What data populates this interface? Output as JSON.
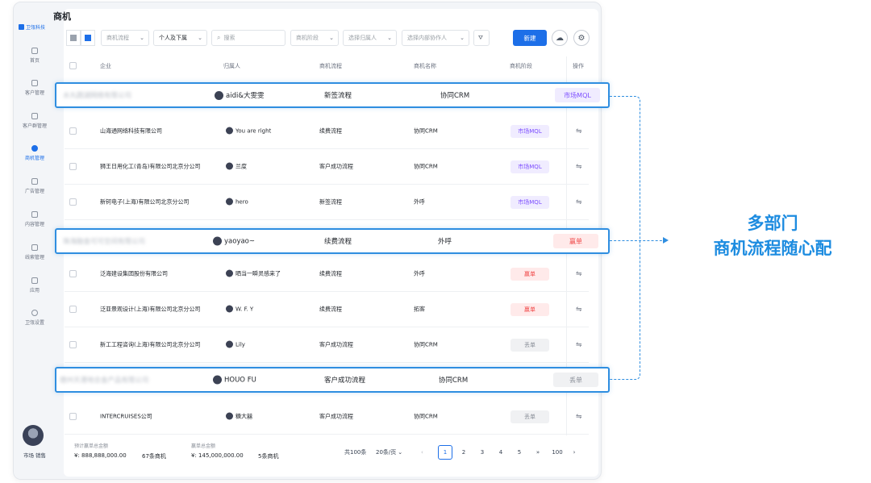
{
  "app": {
    "logo_text": "卫瓴科技",
    "page_title": "商机"
  },
  "sidebar": {
    "items": [
      {
        "label": "首页",
        "icon": "home-icon"
      },
      {
        "label": "客户管理",
        "icon": "customer-icon"
      },
      {
        "label": "客户群管理",
        "icon": "group-icon"
      },
      {
        "label": "商机管理",
        "icon": "opportunity-icon",
        "active": true
      },
      {
        "label": "广告管理",
        "icon": "ad-icon"
      },
      {
        "label": "内容管理",
        "icon": "content-icon"
      },
      {
        "label": "线索管理",
        "icon": "lead-icon"
      },
      {
        "label": "应用",
        "icon": "apps-icon"
      },
      {
        "label": "卫瓴设置",
        "icon": "settings-icon"
      }
    ],
    "user_label": "市场 销售"
  },
  "toolbar": {
    "process_filter": "商机流程",
    "scope_filter": "个人及下属",
    "search_placeholder": "搜索",
    "stage_filter": "商机阶段",
    "owner_filter": "选择归属人",
    "collab_filter": "选择内部协作人",
    "new_label": "新建"
  },
  "table": {
    "columns": [
      "企业",
      "归属人",
      "商机流程",
      "商机名称",
      "商机阶段",
      "操作"
    ],
    "rows": [
      {
        "company": "山海通网络科技有限公司",
        "owner": "You are right",
        "process": "续费流程",
        "name": "协同CRM",
        "stage": "市场MQL",
        "stage_type": "mql"
      },
      {
        "company": "狮王日用化工(青岛)有限公司北京分公司",
        "owner": "兰度",
        "process": "客户成功流程",
        "name": "协同CRM",
        "stage": "市场MQL",
        "stage_type": "mql"
      },
      {
        "company": "新钶电子(上海)有限公司北京分公司",
        "owner": "hero",
        "process": "新签流程",
        "name": "外呼",
        "stage": "市场MQL",
        "stage_type": "mql"
      },
      {
        "company": "泛海建设集团股份有限公司",
        "owner": "晒当一瞬灵感来了",
        "process": "续费流程",
        "name": "外呼",
        "stage": "赢单",
        "stage_type": "win"
      },
      {
        "company": "泛亚景观设计(上海)有限公司北京分公司",
        "owner": "W. F. Y",
        "process": "续费流程",
        "name": "拓客",
        "stage": "赢单",
        "stage_type": "win"
      },
      {
        "company": "新工工程咨询(上海)有限公司北京分公司",
        "owner": "Lily",
        "process": "客户成功流程",
        "name": "协同CRM",
        "stage": "丢单",
        "stage_type": "lost"
      },
      {
        "company": "INTERCRUISES公司",
        "owner": "糖大囍",
        "process": "客户成功流程",
        "name": "协同CRM",
        "stage": "丢单",
        "stage_type": "lost"
      }
    ]
  },
  "highlights": [
    {
      "company": "水丸圆湖网络有限公司",
      "owner": "aidi&大雯雯",
      "process": "新签流程",
      "name": "协同CRM",
      "stage": "市场MQL",
      "stage_type": "mql"
    },
    {
      "company": "珠海融金可可空间有限公司",
      "owner": "yaoyao~",
      "process": "续费流程",
      "name": "外呼",
      "stage": "赢单",
      "stage_type": "win"
    },
    {
      "company": "德州天港地合金产品有限公司",
      "owner": "HOUO FU",
      "process": "客户成功流程",
      "name": "协同CRM",
      "stage": "丢单",
      "stage_type": "lost"
    }
  ],
  "slogan": {
    "line1": "多部门",
    "line2": "商机流程随心配"
  },
  "footer": {
    "est_label": "预计赢单总金额",
    "est_value": "¥: 888,888,000.00",
    "est_count": "67条商机",
    "win_label": "赢单总金额",
    "win_value": "¥: 145,000,000.00",
    "win_count": "5条商机",
    "total": "共100条",
    "page_size": "20条/页",
    "pages": [
      "1",
      "2",
      "3",
      "4",
      "5",
      "»",
      "100"
    ]
  },
  "colors": {
    "accent": "#1d6fe8",
    "highlight": "#2f8ee0",
    "mql": "#7c4dff",
    "win": "#f04747",
    "lost": "#8a8f98"
  }
}
